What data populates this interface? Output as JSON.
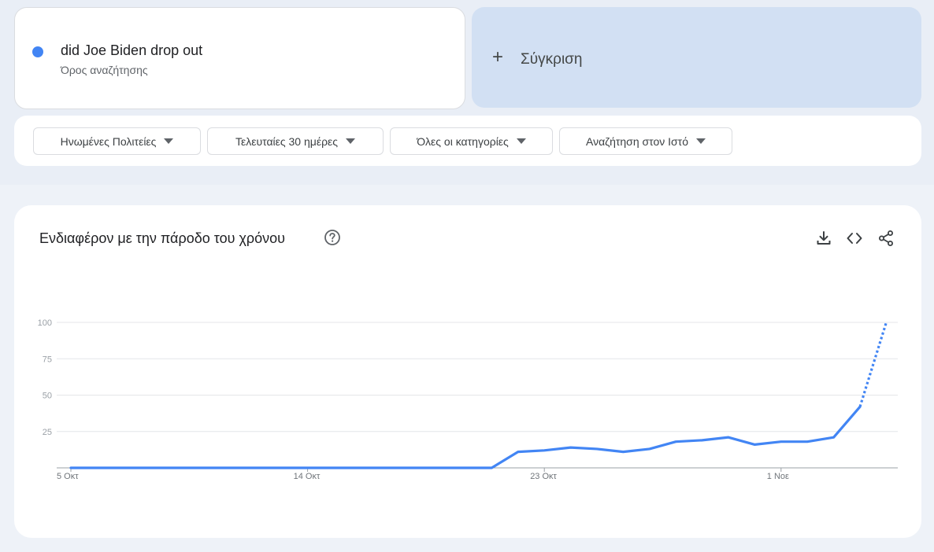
{
  "search_term": {
    "title": "did Joe Biden drop out",
    "subtitle": "Όρος αναζήτησης",
    "color": "#4285f4"
  },
  "compare": {
    "plus": "+",
    "label": "Σύγκριση"
  },
  "filters": [
    {
      "label": "Ηνωμένες Πολιτείες"
    },
    {
      "label": "Τελευταίες 30 ημέρες"
    },
    {
      "label": "Όλες οι κατηγορίες"
    },
    {
      "label": "Αναζήτηση στον Ιστό"
    }
  ],
  "chart_section": {
    "title": "Ενδιαφέρον με την πάροδο του χρόνου",
    "icons": [
      "help-icon",
      "download-icon",
      "embed-icon",
      "share-icon"
    ]
  },
  "chart_data": {
    "type": "line",
    "title": "Ενδιαφέρον με την πάροδο του χρόνου",
    "xlabel": "",
    "ylabel": "",
    "ylim": [
      0,
      100
    ],
    "y_ticks": [
      "100",
      "75",
      "50",
      "25"
    ],
    "x_ticks": [
      "5 Οκτ",
      "14 Οκτ",
      "23 Οκτ",
      "1 Νοε"
    ],
    "grid": true,
    "x": [
      "5 Οκτ",
      "6 Οκτ",
      "7 Οκτ",
      "8 Οκτ",
      "9 Οκτ",
      "10 Οκτ",
      "11 Οκτ",
      "12 Οκτ",
      "13 Οκτ",
      "14 Οκτ",
      "15 Οκτ",
      "16 Οκτ",
      "17 Οκτ",
      "18 Οκτ",
      "19 Οκτ",
      "20 Οκτ",
      "21 Οκτ",
      "22 Οκτ",
      "23 Οκτ",
      "24 Οκτ",
      "25 Οκτ",
      "26 Οκτ",
      "27 Οκτ",
      "28 Οκτ",
      "29 Οκτ",
      "30 Οκτ",
      "31 Οκτ",
      "1 Νοε",
      "2 Νοε",
      "3 Νοε",
      "4 Νοε"
    ],
    "series": [
      {
        "color": "#4285f4",
        "values": [
          0,
          0,
          0,
          0,
          0,
          0,
          0,
          0,
          0,
          0,
          0,
          0,
          0,
          0,
          0,
          0,
          0,
          11,
          12,
          14,
          13,
          11,
          13,
          18,
          19,
          21,
          16,
          18,
          18,
          21,
          42,
          100
        ],
        "partial_from_index": 30
      }
    ]
  }
}
